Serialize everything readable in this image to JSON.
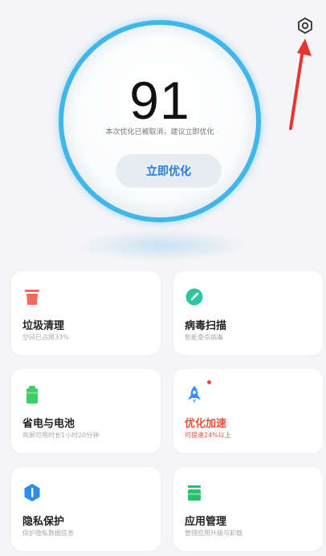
{
  "header": {
    "settings_icon": "gear-icon"
  },
  "score": {
    "value": "91",
    "hint": "本次优化已被取消，建议立即优化",
    "optimize_label": "立即优化",
    "ring_color": "#3fb6ec",
    "button_text_color": "#2b7ce0"
  },
  "annotation": {
    "arrow_color": "#e8342f"
  },
  "cards": [
    {
      "title": "垃圾清理",
      "subtitle": "空间已占用33%",
      "icon": "trash-icon",
      "icon_color": "#f26a5b"
    },
    {
      "title": "病毒扫描",
      "subtitle": "智能查杀病毒",
      "icon": "shield-check-icon",
      "icon_color": "#2bc7a0"
    },
    {
      "title": "省电与电池",
      "subtitle": "亮屏可用时长1小时20分钟",
      "icon": "battery-icon",
      "icon_color": "#3ecf6b"
    },
    {
      "title": "优化加速",
      "subtitle": "可提速24%以上",
      "icon": "rocket-icon",
      "icon_color": "#3b8ff0",
      "alert": true,
      "alert_color": "#e4533a"
    },
    {
      "title": "隐私保护",
      "subtitle": "保护隐私数据信息",
      "icon": "privacy-shield-icon",
      "icon_color": "#2f8de8"
    },
    {
      "title": "应用管理",
      "subtitle": "管理应用升级与卸载",
      "icon": "app-manage-icon",
      "icon_color": "#2cc06a"
    }
  ]
}
